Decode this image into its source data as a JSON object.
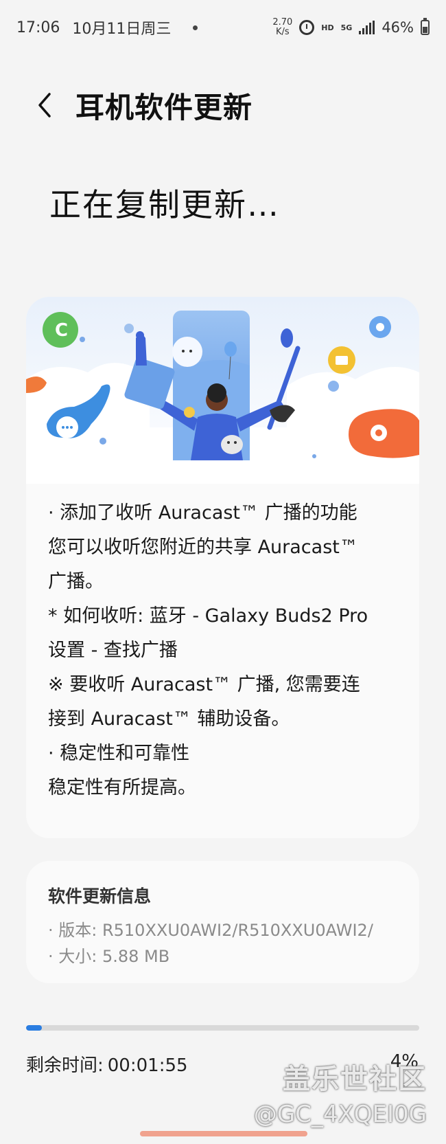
{
  "status_bar": {
    "time": "17:06",
    "date": "10月11日周三",
    "speed_value": "2.70",
    "speed_unit": "K/s",
    "hd": "HD",
    "network": "5G",
    "battery": "46%",
    "icons": [
      "alarm-icon",
      "signal-icon",
      "battery-icon"
    ]
  },
  "header": {
    "title": "耳机软件更新",
    "back_icon": "chevron-left-icon"
  },
  "status_heading": "正在复制更新…",
  "release_notes": [
    "· 添加了收听 Auracast™ 广播的功能",
    "您可以收听您附近的共享 Auracast™",
    "广播。",
    "* 如何收听: 蓝牙 - Galaxy Buds2 Pro",
    "设置 - 查找广播",
    "※ 要收听 Auracast™ 广播, 您需要连",
    "接到 Auracast™ 辅助设备。",
    "· 稳定性和可靠性",
    "稳定性有所提高。"
  ],
  "info": {
    "title": "软件更新信息",
    "version": "· 版本: R510XXU0AWI2/R510XXU0AWI2/",
    "size": "· 大小: 5.88 MB"
  },
  "progress": {
    "fraction": 0.04,
    "remaining_label": "剩余时间:",
    "remaining_value": "00:01:55",
    "percent": "4%"
  },
  "watermark": {
    "line1": "盖乐世社区",
    "line2": "@GC_4XQEI0G"
  },
  "colors": {
    "accent": "#2a7de1",
    "background": "#f4f4f4",
    "card": "#fafafa"
  }
}
